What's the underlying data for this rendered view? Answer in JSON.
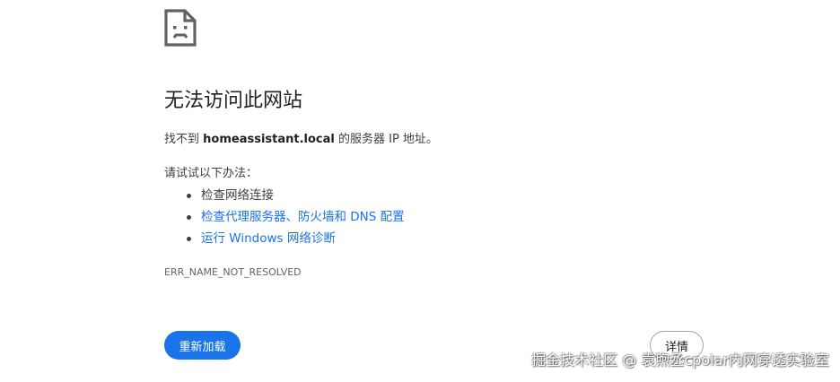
{
  "error_page": {
    "title": "无法访问此网站",
    "description_prefix": "找不到 ",
    "hostname": "homeassistant.local",
    "description_suffix": " 的服务器 IP 地址。",
    "try_label": "请试试以下办法：",
    "suggestions": [
      {
        "label": "检查网络连接",
        "is_link": false
      },
      {
        "label": "检查代理服务器、防火墙和 DNS 配置",
        "is_link": true
      },
      {
        "label": "运行 Windows 网络诊断",
        "is_link": true
      }
    ],
    "error_code": "ERR_NAME_NOT_RESOLVED",
    "reload_label": "重新加载",
    "details_label": "详情",
    "icon": "sad-page-icon"
  },
  "watermark": {
    "text": "掘金技术社区 @ 袁煦丞cpolar内网穿透实验室"
  },
  "colors": {
    "accent": "#1a73e8",
    "text": "#202124",
    "secondary_text": "#3c4043",
    "muted": "#5f6368"
  }
}
